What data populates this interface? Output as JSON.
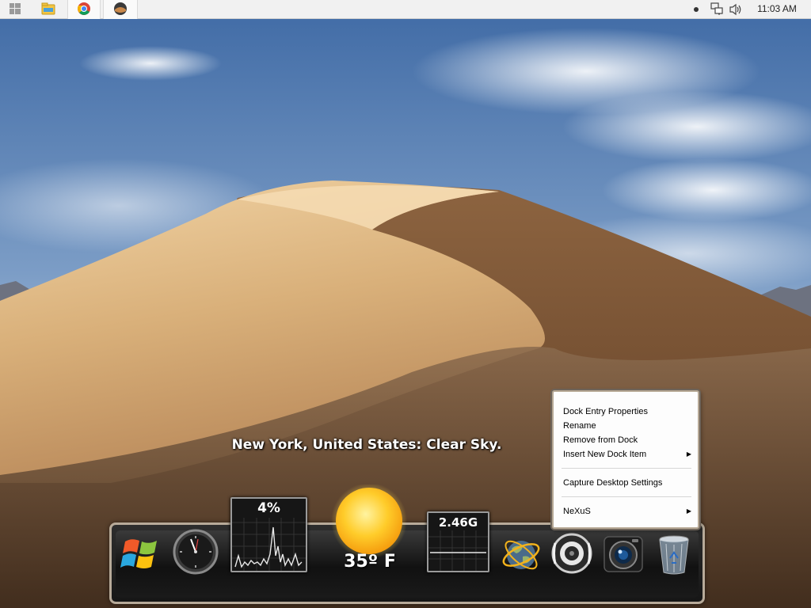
{
  "taskbar": {
    "start": {
      "icon": "windows-logo-icon"
    },
    "pinned": [
      {
        "icon": "file-explorer-icon"
      },
      {
        "icon": "chrome-icon"
      },
      {
        "icon": "dock-app-icon"
      }
    ],
    "tray": {
      "icons": [
        "notification-dot-icon",
        "network-icon",
        "volume-icon"
      ],
      "clock": "11:03 AM"
    }
  },
  "weather": {
    "caption": "New York, United States: Clear Sky.",
    "temperature": "35º F",
    "icon": "sun-icon"
  },
  "dock": {
    "items": [
      {
        "name": "start-menu",
        "icon": "windows-flag-icon"
      },
      {
        "name": "clock",
        "icon": "analog-clock-icon"
      },
      {
        "name": "cpu-meter",
        "icon": "cpu-graph-icon",
        "value": "4%"
      },
      {
        "name": "weather",
        "icon": "sun-icon"
      },
      {
        "name": "memory-meter",
        "icon": "memory-graph-icon",
        "value": "2.46G"
      },
      {
        "name": "network",
        "icon": "globe-icon"
      },
      {
        "name": "speaker",
        "icon": "speaker-icon"
      },
      {
        "name": "camera",
        "icon": "camera-icon"
      },
      {
        "name": "recycle-bin",
        "icon": "trash-icon"
      }
    ]
  },
  "context_menu": {
    "items": [
      {
        "label": "Dock Entry Properties",
        "submenu": false
      },
      {
        "label": "Rename",
        "submenu": false
      },
      {
        "label": "Remove from Dock",
        "submenu": false
      },
      {
        "label": "Insert New Dock Item",
        "submenu": true
      },
      {
        "label": "Capture Desktop Settings",
        "submenu": false
      },
      {
        "label": "NeXuS",
        "submenu": true
      }
    ]
  },
  "colors": {
    "sky": "#6f90b8",
    "sand_light": "#e8c797",
    "sand_dark": "#6b4a2f",
    "menu_border": "#b7a996"
  }
}
